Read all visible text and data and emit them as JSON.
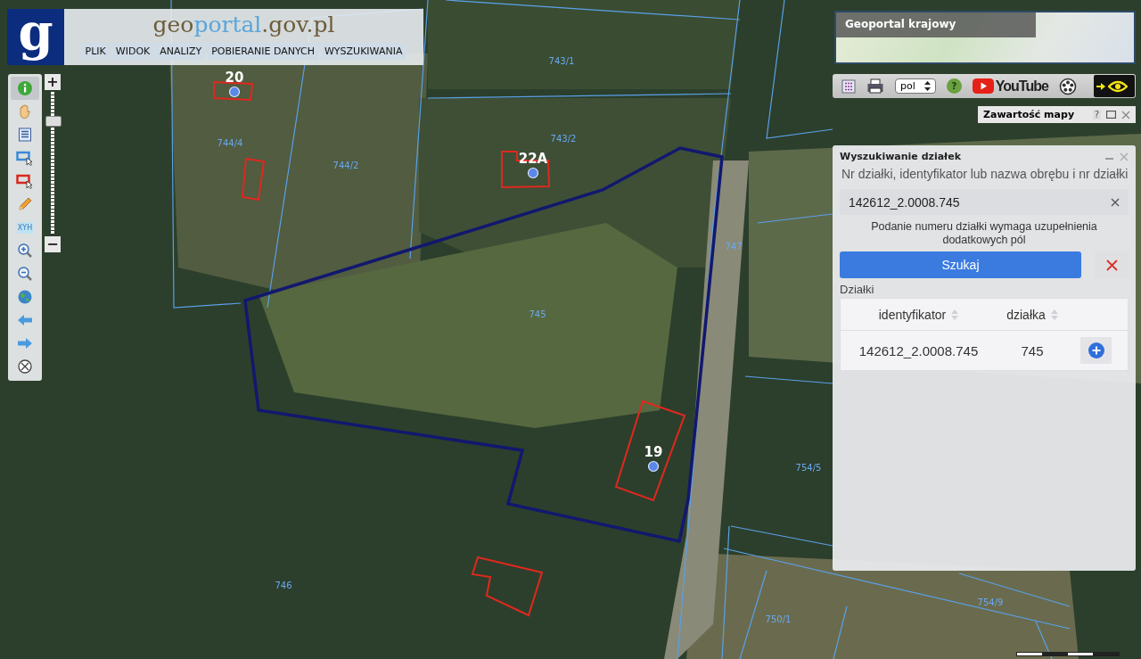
{
  "header": {
    "logo": "g",
    "site_name": [
      {
        "text": "geo",
        "color": "#6e5b3c"
      },
      {
        "text": "portal",
        "color": "#5aa6dc"
      },
      {
        "text": ".gov.pl",
        "color": "#6e5b3c"
      }
    ],
    "menu": [
      "PLIK",
      "WIDOK",
      "ANALIZY",
      "POBIERANIE DANYCH",
      "WYSZUKIWANIA"
    ]
  },
  "tools": [
    {
      "kind": "info",
      "selected": true
    },
    {
      "kind": "pan",
      "selected": false
    },
    {
      "kind": "table",
      "selected": false
    },
    {
      "kind": "select-blue",
      "selected": false
    },
    {
      "kind": "select-red",
      "selected": false
    },
    {
      "kind": "pencil",
      "selected": false
    },
    {
      "kind": "coordinates",
      "label": "XYH",
      "selected": false
    },
    {
      "kind": "zoom-in",
      "selected": false
    },
    {
      "kind": "zoom-out",
      "selected": false
    },
    {
      "kind": "globe",
      "selected": false
    },
    {
      "kind": "back",
      "selected": false
    },
    {
      "kind": "forward",
      "selected": false
    },
    {
      "kind": "crosshair",
      "selected": false
    }
  ],
  "zoom": {
    "in_label": "+",
    "out_label": "−",
    "level": 0.82
  },
  "minimap": {
    "title": "Geoportal krajowy"
  },
  "topbar": {
    "language": "pol",
    "help": "?",
    "video": "YouTube"
  },
  "map_content_panel": {
    "title": "Zawartość mapy",
    "help": "?"
  },
  "search_panel": {
    "title": "Wyszukiwanie działek",
    "label": "Nr działki, identyfikator lub nazwa obrębu i nr działki",
    "value": "142612_2.0008.745",
    "hint": "Podanie numeru działki wymaga uzupełnienia dodatkowych pól",
    "search_button": "Szukaj",
    "results_label": "Działki",
    "columns": [
      "identyfikator",
      "działka"
    ],
    "rows": [
      {
        "cells": [
          "142612_2.0008.745",
          "745"
        ]
      }
    ]
  },
  "map": {
    "parcel_labels": [
      "743/1",
      "743/2",
      "744/4",
      "744/2",
      "745",
      "747",
      "754/5",
      "746",
      "750/1",
      "754/9"
    ],
    "house_numbers": [
      "20",
      "22A",
      "19"
    ]
  }
}
